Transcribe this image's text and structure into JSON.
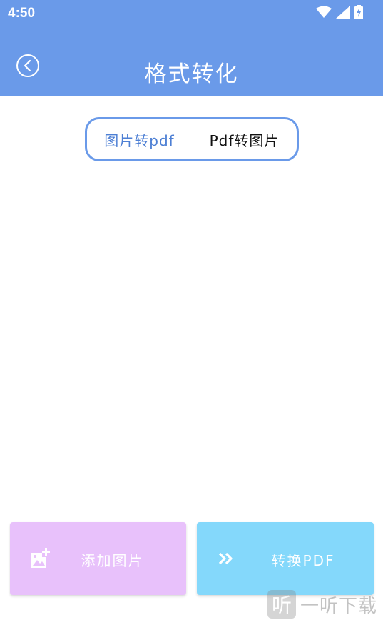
{
  "status": {
    "time": "4:50"
  },
  "header": {
    "title": "格式转化"
  },
  "tabs": [
    {
      "label": "图片转pdf",
      "active": true
    },
    {
      "label": "Pdf转图片",
      "active": false
    }
  ],
  "actions": {
    "add_label": "添加图片",
    "convert_label": "转换PDF"
  },
  "watermark": {
    "glyph": "听",
    "text": "一听下载"
  },
  "colors": {
    "primary": "#6a9ae9",
    "add_button": "#e8c1fb",
    "convert_button": "#84d8fb"
  }
}
